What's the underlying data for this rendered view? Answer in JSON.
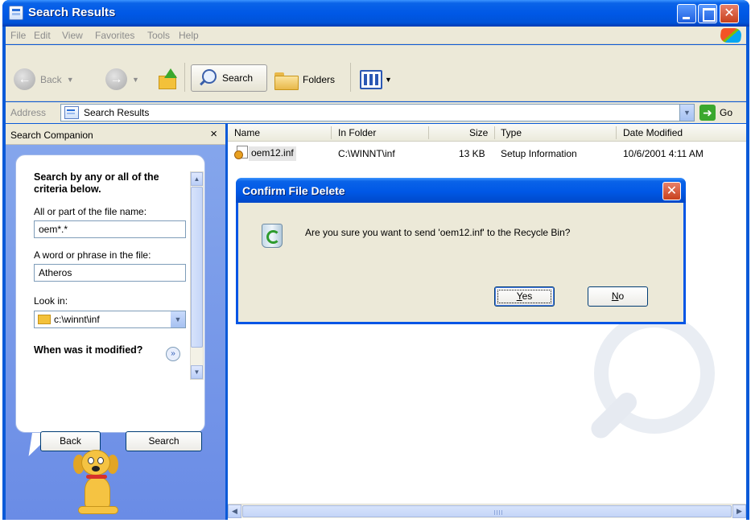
{
  "window": {
    "title": "Search Results"
  },
  "menu": [
    "File",
    "Edit",
    "View",
    "Favorites",
    "Tools",
    "Help"
  ],
  "toolbar": {
    "back_label": "Back",
    "search_label": "Search",
    "folders_label": "Folders"
  },
  "address": {
    "label": "Address",
    "value": "Search Results",
    "go_label": "Go"
  },
  "companion": {
    "title": "Search Companion",
    "close": "×",
    "criteria_title": "Search by any or all of the criteria below.",
    "filename_label": "All or part of the file name:",
    "filename_value": "oem*.*",
    "phrase_label": "A word or phrase in the file:",
    "phrase_value": "Atheros",
    "lookin_label": "Look in:",
    "lookin_value": "c:\\winnt\\inf",
    "when_label": "When was it modified?",
    "back_button": "Back",
    "search_button": "Search"
  },
  "results": {
    "columns": {
      "name": "Name",
      "folder": "In Folder",
      "size": "Size",
      "type": "Type",
      "date": "Date Modified"
    },
    "rows": [
      {
        "name": "oem12.inf",
        "folder": "C:\\WINNT\\inf",
        "size": "13 KB",
        "type": "Setup Information",
        "date": "10/6/2001 4:11 AM"
      }
    ]
  },
  "dialog": {
    "title": "Confirm File Delete",
    "message": "Are you sure you want to send 'oem12.inf' to the Recycle Bin?",
    "yes_first": "Y",
    "yes_rest": "es",
    "no_first": "N",
    "no_rest": "o"
  }
}
